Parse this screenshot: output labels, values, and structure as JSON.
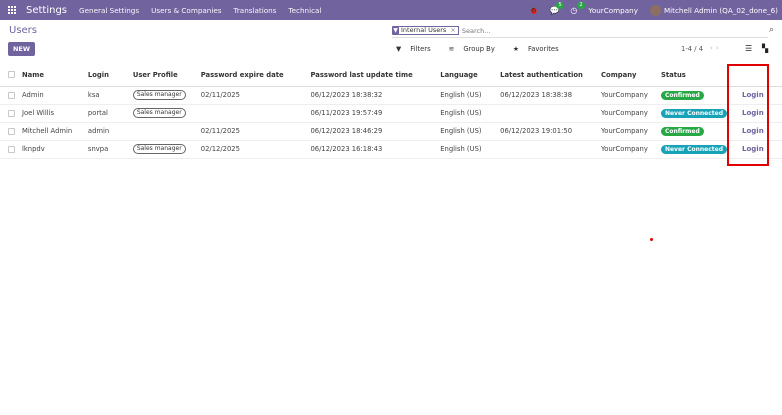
{
  "navbar": {
    "app_name": "Settings",
    "menus": [
      "General Settings",
      "Users & Companies",
      "Translations",
      "Technical"
    ],
    "messages_badge": "5",
    "activity_badge": "2",
    "company": "YourCompany",
    "user": "Mitchell Admin (QA_02_done_6)"
  },
  "control": {
    "breadcrumb": "Users",
    "new_label": "NEW",
    "facet_label": "Internal Users",
    "facet_close": "×",
    "search_placeholder": "Search...",
    "filters_label": "Filters",
    "groupby_label": "Group By",
    "favorites_label": "Favorites",
    "pager": "1-4 / 4"
  },
  "table": {
    "columns": [
      "Name",
      "Login",
      "User Profile",
      "Password expire date",
      "Password last update time",
      "Language",
      "Latest authentication",
      "Company",
      "Status"
    ],
    "rows": [
      {
        "name": "Admin",
        "login": "ksa",
        "profile": "Sales manager",
        "expire": "02/11/2025",
        "updated": "06/12/2023 18:38:32",
        "language": "English (US)",
        "latest_auth": "06/12/2023 18:38:38",
        "company": "YourCompany",
        "status": "Confirmed",
        "action": "Login"
      },
      {
        "name": "Joel Willis",
        "login": "portal",
        "profile": "Sales manager",
        "expire": "",
        "updated": "06/11/2023 19:57:49",
        "language": "English (US)",
        "latest_auth": "",
        "company": "YourCompany",
        "status": "Never Connected",
        "action": "Login"
      },
      {
        "name": "Mitchell Admin",
        "login": "admin",
        "profile": "",
        "expire": "02/11/2025",
        "updated": "06/12/2023 18:46:29",
        "language": "English (US)",
        "latest_auth": "06/12/2023 19:01:50",
        "company": "YourCompany",
        "status": "Confirmed",
        "action": "Login"
      },
      {
        "name": "lknpdv",
        "login": "snvpa",
        "profile": "Sales manager",
        "expire": "02/12/2025",
        "updated": "06/12/2023 16:18:43",
        "language": "English (US)",
        "latest_auth": "",
        "company": "YourCompany",
        "status": "Never Connected",
        "action": "Login"
      }
    ]
  },
  "colors": {
    "brand": "#71639e",
    "confirmed": "#28a745",
    "never_connected": "#17a2b8",
    "highlight": "#e00000"
  }
}
